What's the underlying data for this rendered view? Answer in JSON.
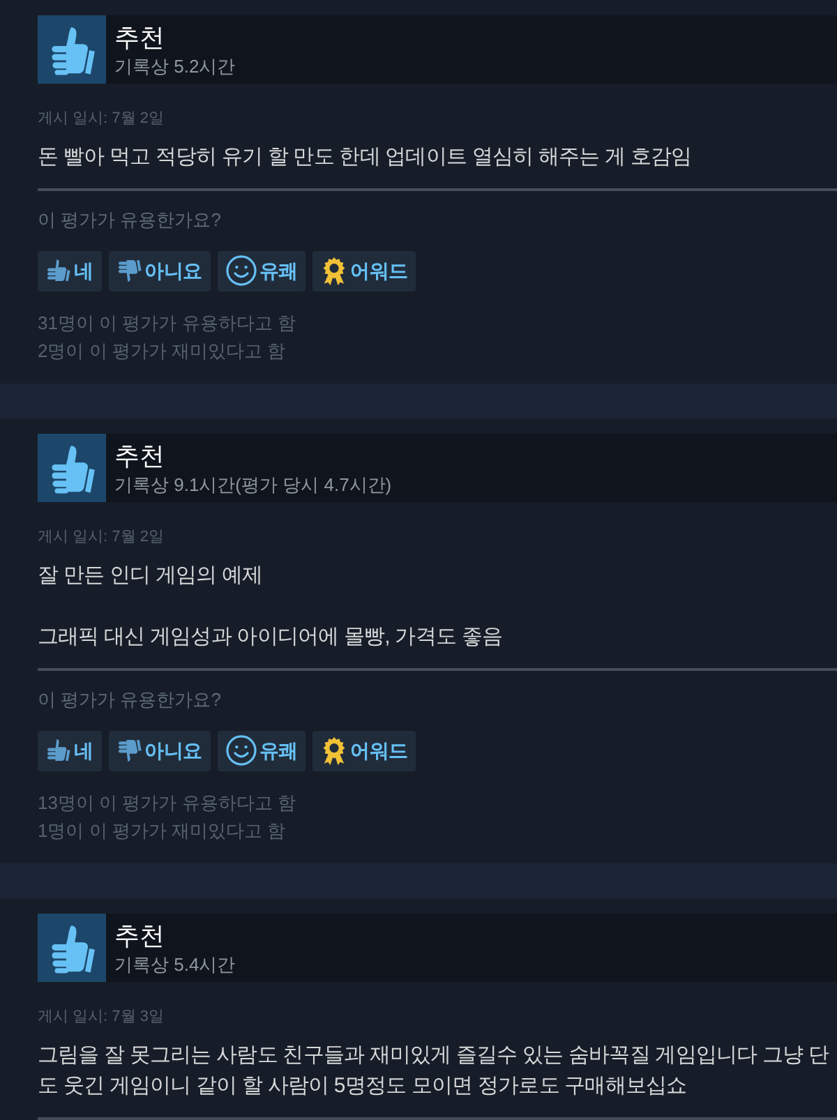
{
  "reviews": [
    {
      "verdict": "추천",
      "hours": "기록상 5.2시간",
      "posted": "게시 일시: 7월 2일",
      "paragraphs": [
        [
          "돈 빨아 먹고 적당히 유기 할 만도 한데 업데이트 열심히 해주는 게 호감임"
        ]
      ],
      "question": "이 평가가 유용한가요?",
      "buttons": [
        {
          "kind": "yes",
          "label": "네"
        },
        {
          "kind": "no",
          "label": "아니요"
        },
        {
          "kind": "funny",
          "label": "유쾌"
        },
        {
          "kind": "award",
          "label": "어워드"
        }
      ],
      "counts": [
        "31명이 이 평가가 유용하다고 함",
        "2명이 이 평가가 재미있다고 함"
      ]
    },
    {
      "verdict": "추천",
      "hours": "기록상 9.1시간(평가 당시 4.7시간)",
      "posted": "게시 일시: 7월 2일",
      "paragraphs": [
        [
          "잘 만든 인디 게임의 예제"
        ],
        [
          "그래픽 대신 게임성과 아이디어에 몰빵, 가격도 좋음"
        ]
      ],
      "question": "이 평가가 유용한가요?",
      "buttons": [
        {
          "kind": "yes",
          "label": "네"
        },
        {
          "kind": "no",
          "label": "아니요"
        },
        {
          "kind": "funny",
          "label": "유쾌"
        },
        {
          "kind": "award",
          "label": "어워드"
        }
      ],
      "counts": [
        "13명이 이 평가가 유용하다고 함",
        "1명이 이 평가가 재미있다고 함"
      ]
    },
    {
      "verdict": "추천",
      "hours": "기록상 5.4시간",
      "posted": "게시 일시: 7월 3일",
      "paragraphs": [
        [
          "그림을 잘 못그리는 사람도 친구들과 재미있게 즐길수 있는 숨바꼭질 게임입니다 그냥 단",
          "도 웃긴 게임이니 같이 할 사람이 5명정도 모이면 정가로도 구매해보십쇼"
        ]
      ]
    }
  ]
}
